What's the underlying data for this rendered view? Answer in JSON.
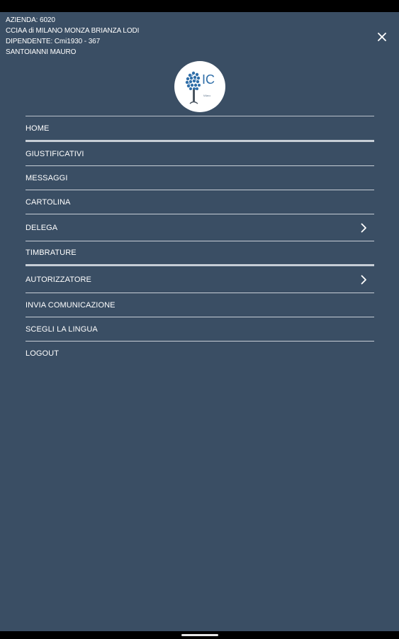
{
  "header": {
    "azienda": "AZIENDA: 6020",
    "ente": "CCIAA di MILANO MONZA BRIANZA LODI",
    "dipendente": "DIPENDENTE: Cmi1930 - 367",
    "nome": "SANTOIANNI MAURO"
  },
  "logo": {
    "text": "IC",
    "caption": "Milano"
  },
  "menu": {
    "items": [
      {
        "label": "HOME"
      },
      {
        "label": "GIUSTIFICATIVI"
      },
      {
        "label": "MESSAGGI"
      },
      {
        "label": "CARTOLINA"
      },
      {
        "label": "DELEGA"
      },
      {
        "label": "TIMBRATURE"
      },
      {
        "label": "AUTORIZZATORE"
      },
      {
        "label": "INVIA COMUNICAZIONE"
      },
      {
        "label": "SCEGLI LA LINGUA"
      },
      {
        "label": "LOGOUT"
      }
    ]
  },
  "icons": {
    "close": "close-icon",
    "submenu": "chevron-right-icon"
  },
  "colors": {
    "background": "#3a4e64",
    "text": "#ffffff",
    "divider": "#c7ced6"
  }
}
